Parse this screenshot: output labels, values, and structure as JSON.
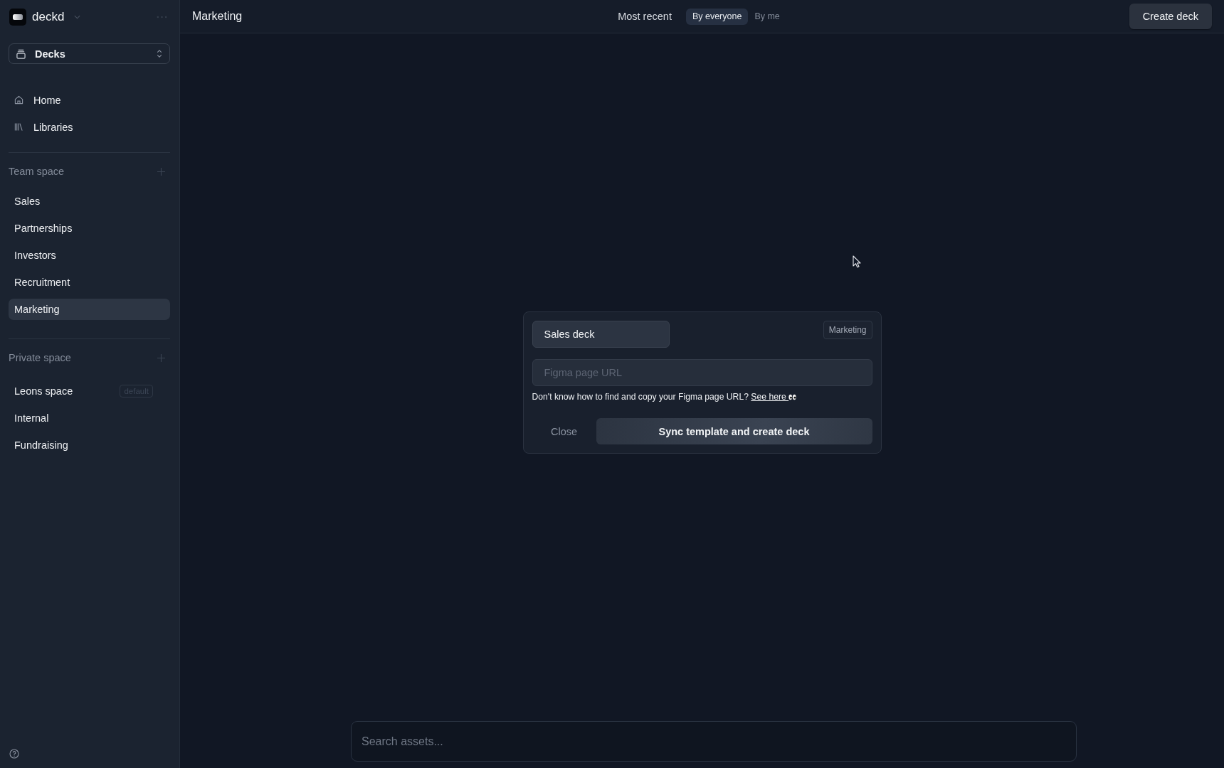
{
  "workspace": {
    "name": "deckd"
  },
  "section_select": {
    "label": "Decks"
  },
  "nav": [
    {
      "label": "Home",
      "kind": "home"
    },
    {
      "label": "Libraries",
      "kind": "libraries"
    }
  ],
  "team_space": {
    "title": "Team space",
    "items": [
      {
        "label": "Sales",
        "selected": false
      },
      {
        "label": "Partnerships",
        "selected": false
      },
      {
        "label": "Investors",
        "selected": false
      },
      {
        "label": "Recruitment",
        "selected": false
      },
      {
        "label": "Marketing",
        "selected": true
      }
    ]
  },
  "private_space": {
    "title": "Private space",
    "items": [
      {
        "label": "Leons space",
        "selected": false,
        "tag": "default"
      },
      {
        "label": "Internal",
        "selected": false
      },
      {
        "label": "Fundraising",
        "selected": false
      }
    ]
  },
  "header": {
    "title": "Marketing",
    "sort": "Most recent",
    "filters": [
      {
        "label": "By everyone",
        "selected": true
      },
      {
        "label": "By me",
        "selected": false
      }
    ],
    "action": "Create deck"
  },
  "dialog": {
    "name_field": {
      "value": "Sales deck"
    },
    "space_tag": "Marketing",
    "url_field": {
      "placeholder": "Figma page URL"
    },
    "help_text": "Don't know how to find and copy your Figma page URL?",
    "help_link": "See here",
    "close": "Close",
    "submit": "Sync template and create deck"
  },
  "search": {
    "placeholder": "Search assets..."
  }
}
